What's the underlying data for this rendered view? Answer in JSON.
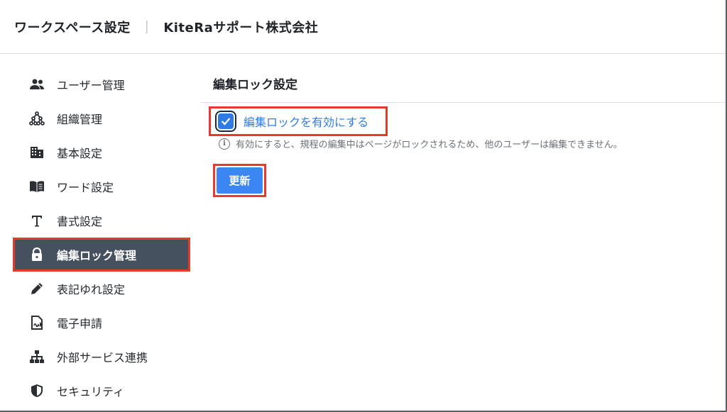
{
  "header": {
    "title": "ワークスペース設定",
    "separator": "｜",
    "org": "KiteRaサポート株式会社"
  },
  "sidebar": {
    "items": [
      {
        "label": "ユーザー管理",
        "icon": "users-icon"
      },
      {
        "label": "組織管理",
        "icon": "org-chart-icon"
      },
      {
        "label": "基本設定",
        "icon": "building-icon"
      },
      {
        "label": "ワード設定",
        "icon": "book-icon"
      },
      {
        "label": "書式設定",
        "icon": "text-format-icon"
      },
      {
        "label": "編集ロック管理",
        "icon": "lock-icon",
        "active": true
      },
      {
        "label": "表記ゆれ設定",
        "icon": "pencil-icon"
      },
      {
        "label": "電子申請",
        "icon": "document-signature-icon"
      },
      {
        "label": "外部サービス連携",
        "icon": "sitemap-icon"
      },
      {
        "label": "セキュリティ",
        "icon": "shield-icon"
      }
    ]
  },
  "main": {
    "section_title": "編集ロック設定",
    "checkbox_label": "編集ロックを有効にする",
    "checkbox_checked": true,
    "hint": "有効にすると、規程の編集中はページがロックされるため、他のユーザーは編集できません。",
    "update_button": "更新"
  },
  "colors": {
    "accent": "#3b86f2",
    "active_nav_bg": "#46515f",
    "highlight": "#e53a2d"
  }
}
